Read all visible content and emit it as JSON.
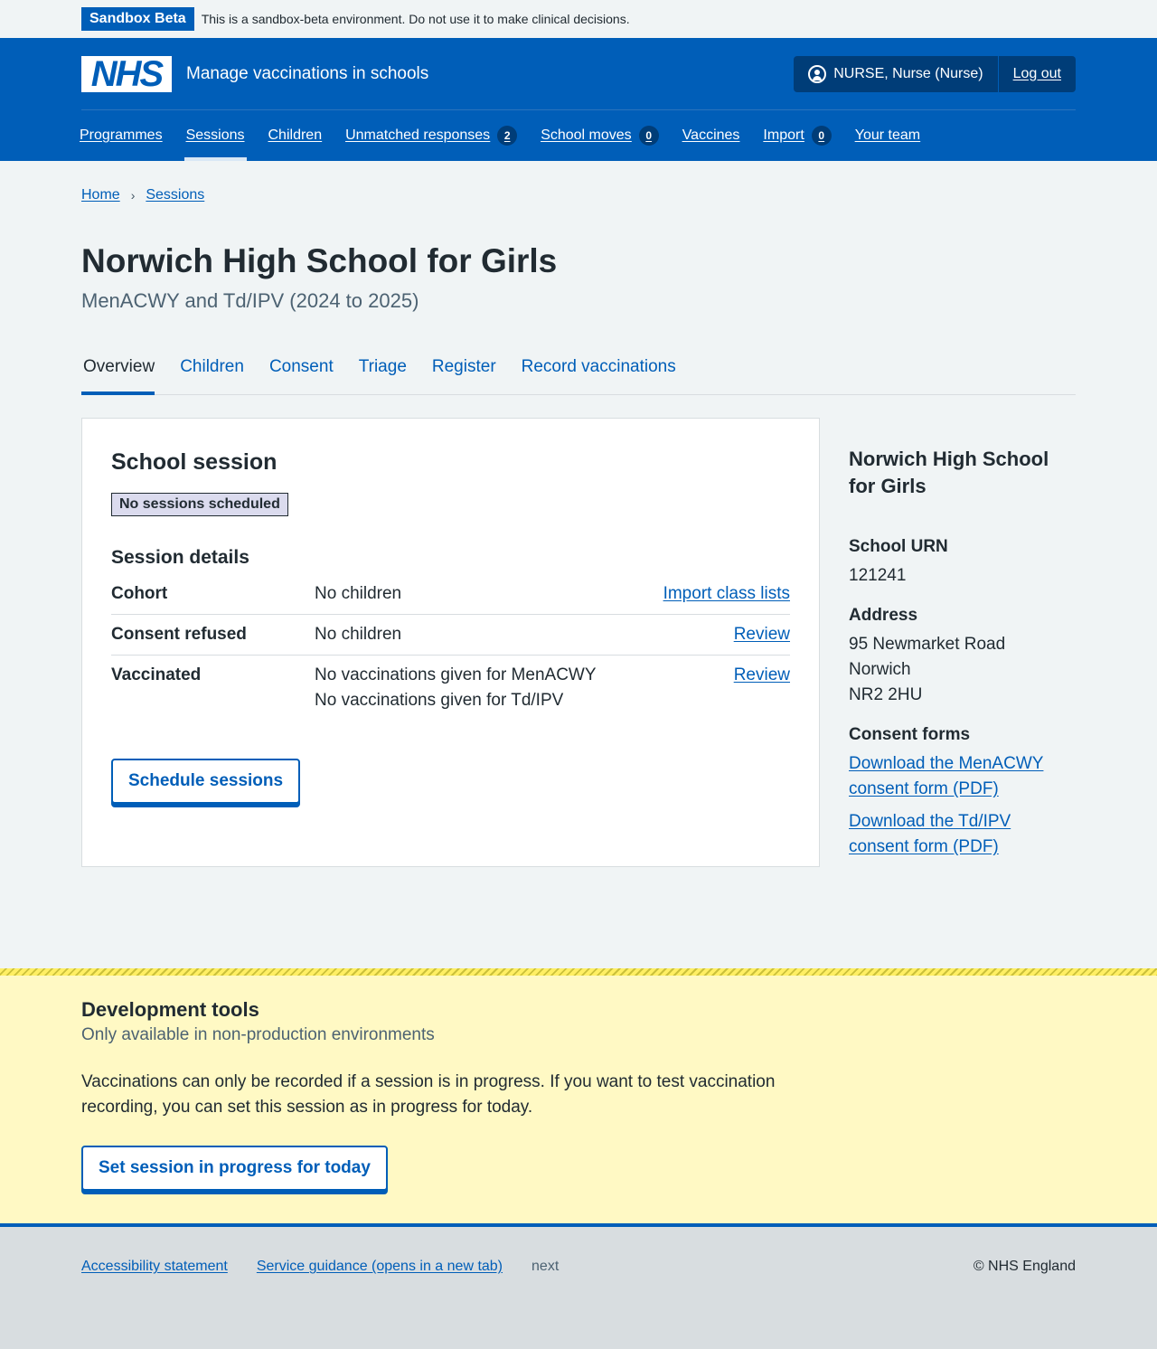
{
  "banner": {
    "tag": "Sandbox Beta",
    "text": "This is a sandbox-beta environment. Do not use it to make clinical decisions."
  },
  "header": {
    "logo_text": "NHS",
    "service_name": "Manage vaccinations in schools",
    "user_label": "NURSE, Nurse (Nurse)",
    "logout_label": "Log out",
    "nav": [
      {
        "label": "Programmes"
      },
      {
        "label": "Sessions",
        "active": true
      },
      {
        "label": "Children"
      },
      {
        "label": "Unmatched responses",
        "count": "2"
      },
      {
        "label": "School moves",
        "count": "0"
      },
      {
        "label": "Vaccines"
      },
      {
        "label": "Import",
        "count": "0"
      },
      {
        "label": "Your team"
      }
    ]
  },
  "breadcrumb": {
    "home": "Home",
    "sessions": "Sessions"
  },
  "page": {
    "title": "Norwich High School for Girls",
    "caption": "MenACWY and Td/IPV (2024 to 2025)"
  },
  "tabs": [
    "Overview",
    "Children",
    "Consent",
    "Triage",
    "Register",
    "Record vaccinations"
  ],
  "card": {
    "title": "School session",
    "status_tag": "No sessions scheduled",
    "details_title": "Session details",
    "rows": [
      {
        "key": "Cohort",
        "value": "No children",
        "value2": "",
        "action": "Import class lists"
      },
      {
        "key": "Consent refused",
        "value": "No children",
        "value2": "",
        "action": "Review"
      },
      {
        "key": "Vaccinated",
        "value": "No vaccinations given for MenACWY",
        "value2": "No vaccinations given for Td/IPV",
        "action": "Review"
      }
    ],
    "button": "Schedule sessions"
  },
  "aside": {
    "title": "Norwich High School for Girls",
    "urn_label": "School URN",
    "urn": "121241",
    "address_label": "Address",
    "address_line1": "95 Newmarket Road",
    "address_line2": "Norwich",
    "address_line3": "NR2 2HU",
    "consent_label": "Consent forms",
    "link1": "Download the MenACWY consent form (PDF)",
    "link2": "Download the Td/IPV consent form (PDF)"
  },
  "dev": {
    "title": "Development tools",
    "subtitle": "Only available in non-production environments",
    "text": "Vaccinations can only be recorded if a session is in progress. If you want to test vaccination recording, you can set this session as in progress for today.",
    "button": "Set session in progress for today"
  },
  "footer": {
    "accessibility": "Accessibility statement",
    "guidance": "Service guidance (opens in a new tab)",
    "next": "next",
    "copyright": "© NHS England"
  },
  "colors": {
    "brand": "#005eb8",
    "dark_blue": "#003d78",
    "text": "#212b32",
    "page_bg": "#f0f4f5",
    "dev_bg": "#fff9c4",
    "tag_grey": "#dbdbee"
  }
}
